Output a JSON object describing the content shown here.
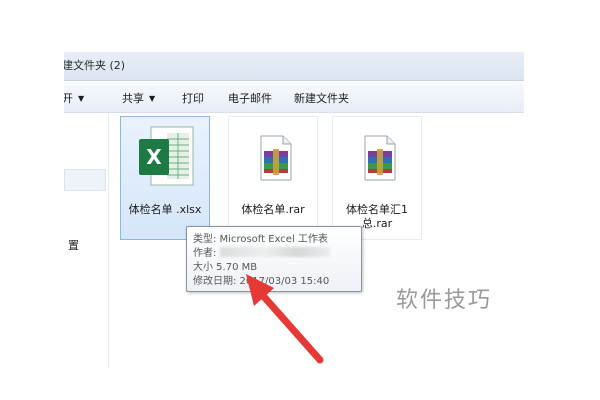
{
  "window": {
    "title": "建文件夹 (2)"
  },
  "toolbar": {
    "items": [
      {
        "label": "开",
        "has_dropdown": true
      },
      {
        "label": "共享",
        "has_dropdown": true
      },
      {
        "label": "打印",
        "has_dropdown": false
      },
      {
        "label": "电子邮件",
        "has_dropdown": false
      },
      {
        "label": "新建文件夹",
        "has_dropdown": false
      }
    ]
  },
  "nav": {
    "item_label": "置"
  },
  "files": [
    {
      "name": "体检名单 .xlsx",
      "icon": "excel-icon",
      "selected": true
    },
    {
      "name": "体检名单.rar",
      "icon": "rar-archive-icon",
      "selected": false
    },
    {
      "name": "体检名单汇1总.rar",
      "icon": "rar-archive-icon",
      "selected": false
    }
  ],
  "tooltip": {
    "type_line": "类型: Microsoft Excel 工作表",
    "author_label": "作者:",
    "size_line": "大小 5.70 MB",
    "modified_line": "修改日期: 2017/03/03 15:40"
  },
  "watermark": {
    "text": "软件技巧"
  },
  "colors": {
    "selection": "#d5e6fa",
    "arrow": "#e53935",
    "excel_green": "#1e7a45"
  }
}
